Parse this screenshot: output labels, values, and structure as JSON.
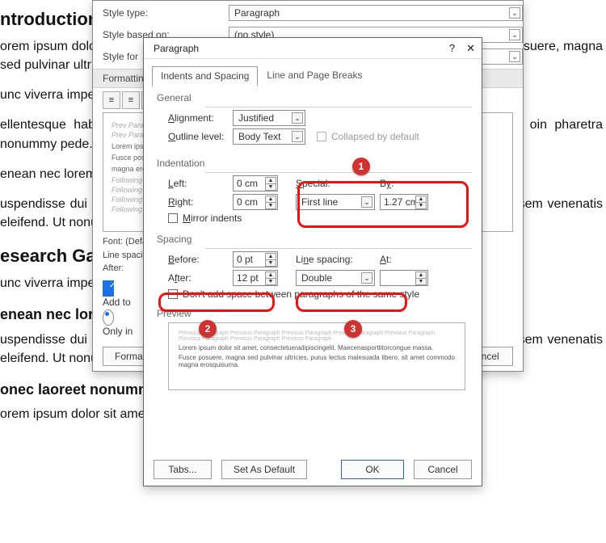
{
  "document": {
    "h1": "ntroduction",
    "p1": "orem ipsum dolor sit amet, consectetuer adipiscing elit. Maecenas porttitor congue usce  posuere, magna sed pulvinar ultricies, purus lectus malesuada libero, sit ommodo magna eros quis urna.",
    "p2": "unc viverra imperdiet enim. Fusce est. Vivamus a tellus.",
    "p3": "ellentesque habitant morbi tristique senectus et netus et malesuada fames ac turpis oin pharetra nonummy pede. Mauris et orci.",
    "p4": "enean nec lorem. In porttitor. Donec laoreet nonummy augue.",
    "p5": "uspendisse  dui  purus,  scelerisque  at,  vulputate  vitae,  pretium  mattis,  nunc.  Mau eque at sem venenatis eleifend. Ut nonummy.",
    "h2": "esearch Gap, Aims & Objectives",
    "p6": "unc viverra imperdiet enim. Fusce est. Vivamus a tellus.",
    "h3": "enean nec lorem",
    "p7": "uspendisse dui purus, scelerisque at, vulputate vitae, pretium mattis, nunc. Mau eque at sem venenatis eleifend. Ut nonummy.",
    "h4": "onec laoreet nonummy augue",
    "p8": "orem ipsum dolor sit amet, consectetuer adipiscing elit. Maecenas porttitor congue"
  },
  "modifyStyle": {
    "styleTypeLabel": "Style type:",
    "styleTypeValue": "Paragraph",
    "styleBasedLabel": "Style based on:",
    "styleBasedValue": "(no style)",
    "styleForLabel": "Style for",
    "formattingLabel": "Formatting",
    "fontLine": "Font: (Default) +Body (Times New Roman)",
    "lineLine": "Line spacing:",
    "afterLine": "After:",
    "prev_header": "Prev Para",
    "prev_lorem": "Lorem ipsum dolor sit amet, consectetuer adipiscing elit.",
    "prev_fusce": "Fusce posuere, magna sed pulvinar",
    "prev_magna": "magna eros quis urna.",
    "prev_foll": "Following Paragraph",
    "addTo": "Add to",
    "onlyIn": "Only in",
    "formatBtn": "Format",
    "cancelBtn": "Cancel"
  },
  "paragraph": {
    "title": "Paragraph",
    "help": "?",
    "close": "✕",
    "tab1": "Indents and Spacing",
    "tab2": "Line and Page Breaks",
    "general": "General",
    "alignmentLabel": "Alignment:",
    "alignmentValue": "Justified",
    "outlineLabel": "Outline level:",
    "outlineValue": "Body Text",
    "collapsed": "Collapsed by default",
    "indentation": "Indentation",
    "leftLabel": "Left:",
    "leftValue": "0 cm",
    "rightLabel": "Right:",
    "rightValue": "0 cm",
    "specialLabel": "Special:",
    "specialValue": "First line",
    "byLabel": "By:",
    "byValue": "1.27 cm",
    "mirror": "Mirror indents",
    "spacing": "Spacing",
    "beforeLabel": "Before:",
    "beforeValue": "0 pt",
    "afterLabel": "After:",
    "afterValue": "12 pt",
    "lineSpacingLabel": "Line spacing:",
    "lineSpacingValue": "Double",
    "atLabel": "At:",
    "atValue": "",
    "dontAdd": "Don't add space between paragraphs of the same style",
    "preview": "Preview",
    "prevGrey": "Previous Paragraph Previous Paragraph Previous Paragraph Previous Paragraph Previous Paragraph Previous Paragraph Previous Paragraph Previous Paragraph",
    "prevBody1": "Lorem ipsum dolor sit amet, consectetueradipiscingelit. Maecenasporttitorcongue massa.",
    "prevBody2": "Fusce posuere, magna sed pulvinar ultricies, purus lectus malesuada libero, sit amet commodo magna erosquisurna.",
    "tabsBtn": "Tabs...",
    "defaultBtn": "Set As Default",
    "okBtn": "OK",
    "cancelBtn": "Cancel"
  },
  "callouts": {
    "one": "1",
    "two": "2",
    "three": "3"
  }
}
